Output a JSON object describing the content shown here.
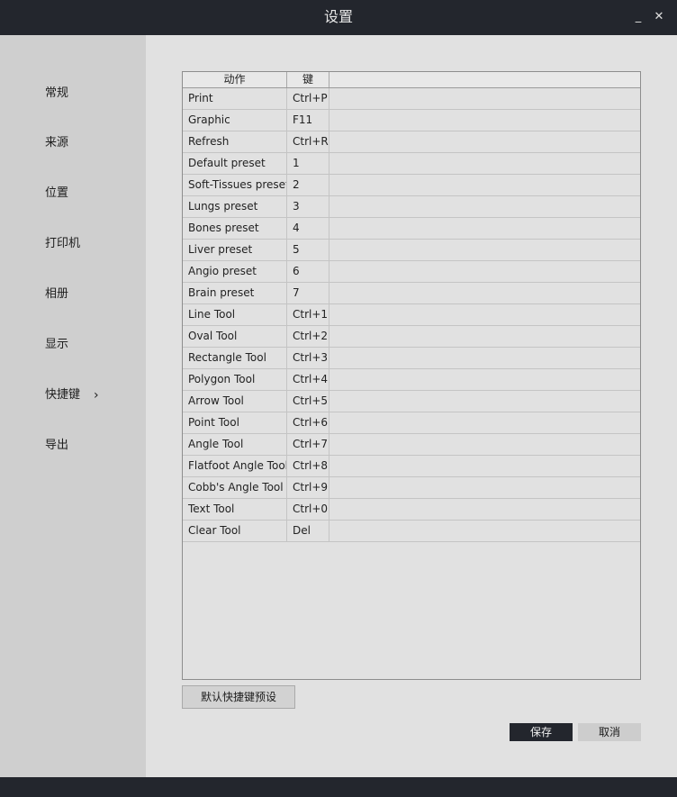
{
  "window": {
    "title": "设置",
    "minimize_label": "_",
    "close_label": "✕",
    "minimize_icon": "minimize-icon",
    "close_icon": "close-icon"
  },
  "sidebar": {
    "items": [
      {
        "label": "常规"
      },
      {
        "label": "来源"
      },
      {
        "label": "位置"
      },
      {
        "label": "打印机"
      },
      {
        "label": "相册"
      },
      {
        "label": "显示"
      },
      {
        "label": "快捷键",
        "active": true,
        "chevron": "›"
      },
      {
        "label": "导出"
      }
    ]
  },
  "shortcuts": {
    "columns": [
      "动作",
      "键"
    ],
    "rows": [
      {
        "action": "Print",
        "key": "Ctrl+P"
      },
      {
        "action": "Graphic",
        "key": "F11"
      },
      {
        "action": "Refresh",
        "key": "Ctrl+R"
      },
      {
        "action": "Default preset",
        "key": "1"
      },
      {
        "action": "Soft-Tissues preset",
        "key": "2"
      },
      {
        "action": "Lungs preset",
        "key": "3"
      },
      {
        "action": "Bones preset",
        "key": "4"
      },
      {
        "action": "Liver preset",
        "key": "5"
      },
      {
        "action": "Angio preset",
        "key": "6"
      },
      {
        "action": "Brain preset",
        "key": "7"
      },
      {
        "action": "Line Tool",
        "key": "Ctrl+1"
      },
      {
        "action": "Oval Tool",
        "key": "Ctrl+2"
      },
      {
        "action": "Rectangle Tool",
        "key": "Ctrl+3"
      },
      {
        "action": "Polygon Tool",
        "key": "Ctrl+4"
      },
      {
        "action": "Arrow Tool",
        "key": "Ctrl+5"
      },
      {
        "action": "Point Tool",
        "key": "Ctrl+6"
      },
      {
        "action": "Angle Tool",
        "key": "Ctrl+7"
      },
      {
        "action": "Flatfoot Angle Tool",
        "key": "Ctrl+8"
      },
      {
        "action": "Cobb's Angle Tool",
        "key": "Ctrl+9"
      },
      {
        "action": "Text Tool",
        "key": "Ctrl+0"
      },
      {
        "action": "Clear Tool",
        "key": "Del"
      }
    ]
  },
  "buttons": {
    "default_preset": "默认快捷键预设",
    "save": "保存",
    "cancel": "取消"
  },
  "colors": {
    "titlebar": "#23262d",
    "sidebar": "#cfcfcf",
    "main": "#e1e1e1",
    "primary_button": "#23262d"
  }
}
